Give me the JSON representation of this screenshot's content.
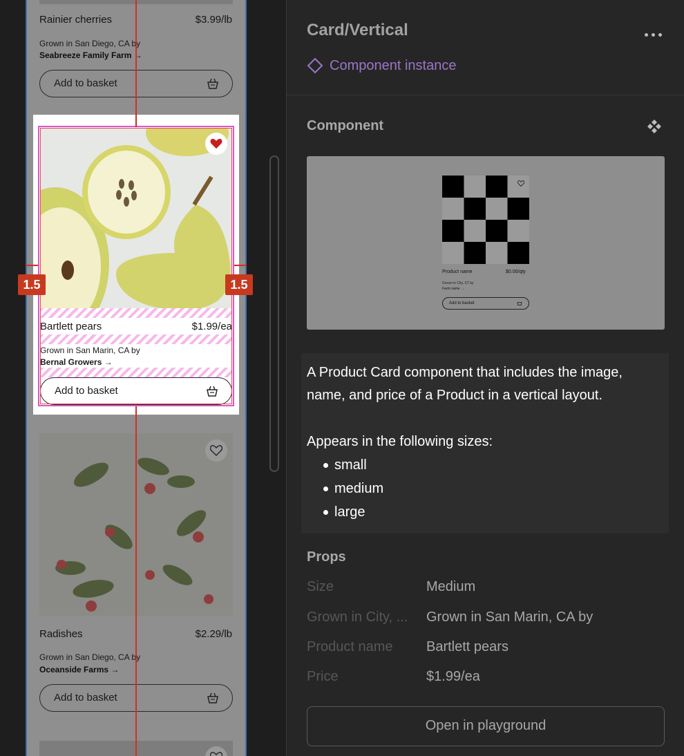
{
  "canvas": {
    "cards": [
      {
        "name": "Rainier cherries",
        "price": "$3.99/lb",
        "origin": "Grown in San Diego, CA by",
        "farm": "Seabreeze Family Farm →",
        "button": "Add to basket"
      },
      {
        "name": "Bartlett pears",
        "price": "$1.99/ea",
        "origin": "Grown in San Marin, CA by",
        "farm": "Bernal Growers →",
        "button": "Add to basket",
        "selected": true,
        "favorited": true
      },
      {
        "name": "Radishes",
        "price": "$2.29/lb",
        "origin": "Grown in San Diego, CA by",
        "farm": "Oceanside Farms →",
        "button": "Add to basket"
      }
    ],
    "measurement_left": "1.5",
    "measurement_right": "1.5",
    "icons": [
      "heart-icon",
      "basket-icon",
      "arrow-right-icon"
    ],
    "colors": {
      "selection_pink": "#d858c8",
      "measure_red": "#c83a1f",
      "frame_blue": "#3f6fb0"
    }
  },
  "panel": {
    "title": "Card/Vertical",
    "instance_label": "Component instance",
    "component_heading": "Component",
    "preview": {
      "name": "Product name",
      "price": "$0.00/qty",
      "origin": "Grown in City, ST by",
      "farm": "Farm name →",
      "button": "Add to basket"
    },
    "description": "A Product Card component that includes the image, name, and price of a Product in a vertical layout.",
    "sizes_intro": "Appears in the following sizes:",
    "sizes": [
      "small",
      "medium",
      "large"
    ],
    "props_heading": "Props",
    "props": [
      {
        "key": "Size",
        "value": "Medium"
      },
      {
        "key": "Grown in City, ...",
        "value": "Grown in San Marin, CA by"
      },
      {
        "key": "Product name",
        "value": "Bartlett pears"
      },
      {
        "key": "Price",
        "value": "$1.99/ea"
      }
    ],
    "playground_button": "Open in playground",
    "colors": {
      "instance_purple": "#9b76c8",
      "panel_bg": "#262626"
    }
  }
}
